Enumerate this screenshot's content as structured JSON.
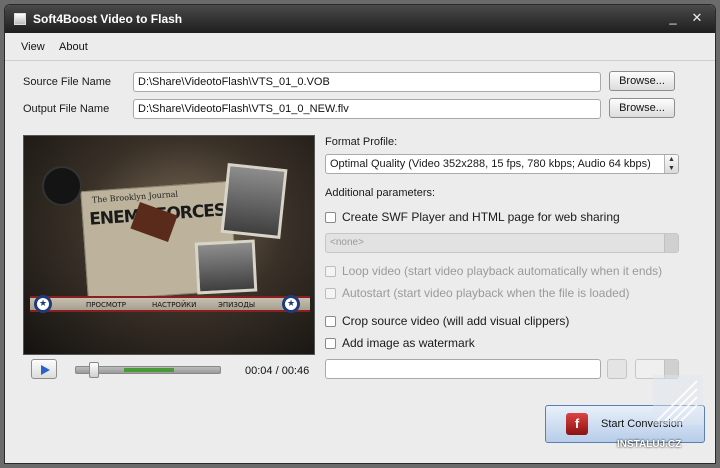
{
  "window": {
    "title": "Soft4Boost Video to Flash",
    "minimize": "_",
    "close": "✕"
  },
  "menu": {
    "items": [
      {
        "label": "View"
      },
      {
        "label": "About"
      }
    ]
  },
  "source": {
    "label": "Source File Name",
    "value": "D:\\Share\\VideotoFlash\\VTS_01_0.VOB",
    "browse": "Browse..."
  },
  "output": {
    "label": "Output File Name",
    "value": "D:\\Share\\VideotoFlash\\VTS_01_0_NEW.flv",
    "browse": "Browse..."
  },
  "preview": {
    "headline": "ENEMY FORCES",
    "paper_title": "The Brooklyn Journal",
    "menu_items": [
      "ПРОСМОТР",
      "НАСТРОЙКИ",
      "ЭПИЗОДЫ"
    ]
  },
  "player": {
    "time": "00:04 / 00:46",
    "progress_fraction": 0.1
  },
  "format": {
    "label": "Format Profile:",
    "selected": "Optimal Quality (Video 352x288, 15 fps, 780 kbps; Audio 64 kbps)"
  },
  "additional": {
    "label": "Additional parameters:"
  },
  "options": {
    "swf": {
      "label": "Create SWF Player and HTML page for web sharing",
      "checked": false
    },
    "player_select": {
      "value": "<none>"
    },
    "loop": {
      "label": "Loop video (start video playback automatically when it ends)",
      "enabled": false
    },
    "autostart": {
      "label": "Autostart (start video playback when the file is loaded)",
      "enabled": false
    },
    "crop": {
      "label": "Crop source video (will add visual clippers)",
      "checked": false
    },
    "watermark": {
      "label": "Add image as watermark",
      "checked": false
    }
  },
  "start": {
    "label": "Start Conversion"
  },
  "site_watermark": {
    "text": "INSTALUJ.CZ"
  },
  "colors": {
    "titlebar": "#1e1e1e",
    "accent_blue": "#2a62c9",
    "flash_red": "#c21e1e"
  }
}
